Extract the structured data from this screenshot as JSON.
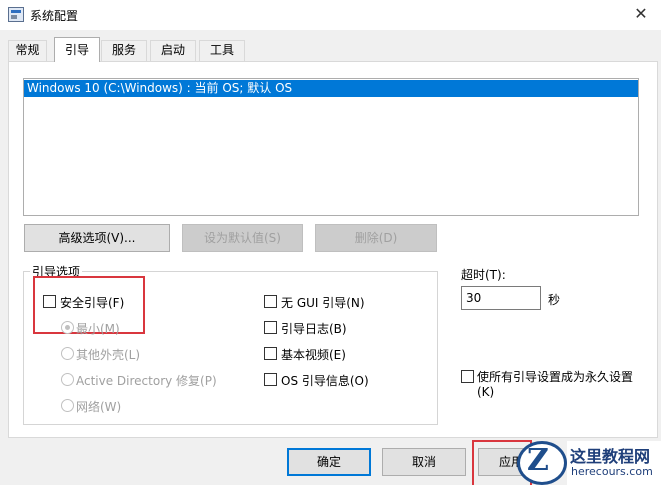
{
  "window": {
    "title": "系统配置",
    "close": "✕"
  },
  "tabs": [
    {
      "label": "常规"
    },
    {
      "label": "引导"
    },
    {
      "label": "服务"
    },
    {
      "label": "启动"
    },
    {
      "label": "工具"
    }
  ],
  "os_list": {
    "items": [
      "Windows 10 (C:\\Windows) : 当前 OS; 默认 OS"
    ]
  },
  "buttons": {
    "advanced": "高级选项(V)...",
    "set_default": "设为默认值(S)",
    "delete": "删除(D)"
  },
  "boot_options": {
    "group_label": "引导选项",
    "safe_boot": "安全引导(F)",
    "minimal": "最小(M)",
    "alternate_shell": "其他外壳(L)",
    "active_directory": "Active Directory 修复(P)",
    "network": "网络(W)",
    "no_gui": "无 GUI 引导(N)",
    "boot_log": "引导日志(B)",
    "base_video": "基本视频(E)",
    "os_boot_info": "OS 引导信息(O)"
  },
  "timeout": {
    "label": "超时(T):",
    "value": "30",
    "unit": "秒"
  },
  "permanent": {
    "label_line1": "使所有引导设置成为永久设置",
    "label_line2": "(K)"
  },
  "footer": {
    "ok": "确定",
    "cancel": "取消",
    "apply": "应用"
  },
  "watermark": {
    "title": "这里教程网",
    "url": "herecours.com",
    "logo_letter": "Z"
  },
  "colors": {
    "selection": "#0078d7",
    "highlight_box": "#d9363e"
  }
}
